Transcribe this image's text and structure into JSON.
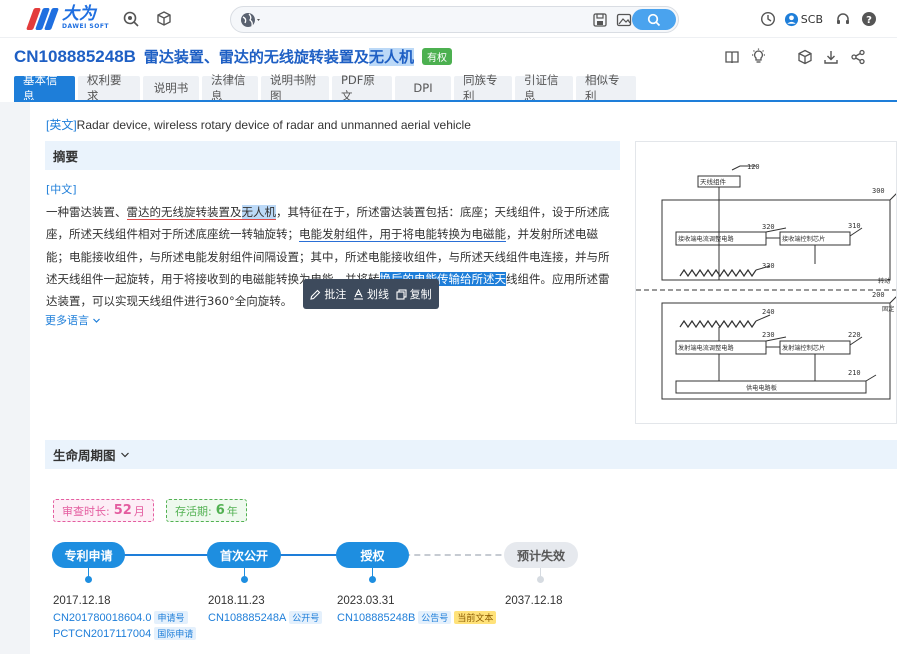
{
  "app": {
    "logo_cn": "大为",
    "logo_en": "DAWEI SOFT"
  },
  "header": {
    "user": "SCB"
  },
  "patent": {
    "id": "CN108885248B",
    "title_pre": "雷达装置、雷达的无线旋转装置及",
    "title_hl": "无人机",
    "status": "有权"
  },
  "tabs": [
    "基本信息",
    "权利要求",
    "说明书",
    "法律信息",
    "说明书附图",
    "PDF原文",
    "DPI",
    "同族专利",
    "引证信息",
    "相似专利"
  ],
  "english": {
    "tag": "[英文]",
    "text": "Radar device, wireless rotary device of radar and unmanned aerial vehicle"
  },
  "abstract": {
    "heading": "摘要",
    "cn_tag": "[中文]",
    "seg": [
      "一种雷达装置、",
      "雷达的无线旋转装置及",
      "无人机",
      "，其特征在于，所述雷达装置包括：底座；天线组件，设于所述底座，所述天线组件相对于所述底座统一转轴旋转；",
      "电能发射组件，用于将电能转换为电磁能",
      "，并发射所述电磁能；电能接收组件，与所述电能发射组件间隔设置；其中，所述电能接收组件，与所述天线组件电连接，并与所述天线组件一起旋转，用于将接收到的电磁能转换为电能，并将转",
      "换后的电能传输给所述天",
      "线组件。应用所述雷达装置，可以实现天线组件进行360°全向旋转。"
    ],
    "more": "更多语言"
  },
  "popup": {
    "annotate": "批注",
    "underline": "划线",
    "copy": "复制"
  },
  "figure": {
    "labels": {
      "n120": "120",
      "n300": "300",
      "n320": "320",
      "n310": "310",
      "n330": "330",
      "n200": "200",
      "n240": "240",
      "n230": "230",
      "n220": "220",
      "n210": "210",
      "antenna": "天线组件",
      "recv_circuit": "接收端电流调整电路",
      "recv_chip": "接收端控制芯片",
      "send_circuit": "发射端电流调整电路",
      "send_chip": "发射端控制芯片",
      "power": "供电电路板",
      "moving": "转动",
      "fixed": "固定"
    }
  },
  "lifecycle": {
    "heading": "生命周期图",
    "review_label": "审查时长:",
    "review_value": "52",
    "review_unit": "月",
    "life_label": "存活期:",
    "life_value": "6",
    "life_unit": "年",
    "stages": [
      {
        "name": "专利申请",
        "date": "2017.12.18",
        "nums": [
          {
            "n": "CN201780018604.0",
            "t": "申请号"
          },
          {
            "n": "PCTCN2017117004",
            "t": "国际申请"
          }
        ]
      },
      {
        "name": "首次公开",
        "date": "2018.11.23",
        "nums": [
          {
            "n": "CN108885248A",
            "t": "公开号"
          }
        ]
      },
      {
        "name": "授权",
        "date": "2023.03.31",
        "nums": [
          {
            "n": "CN108885248B",
            "t": "公告号",
            "t2": "当前文本"
          }
        ]
      },
      {
        "name": "预计失效",
        "date": "2037.12.18",
        "nums": []
      }
    ]
  },
  "colors": {
    "accent": "#1e7ed9",
    "granted": "#4cb050"
  }
}
